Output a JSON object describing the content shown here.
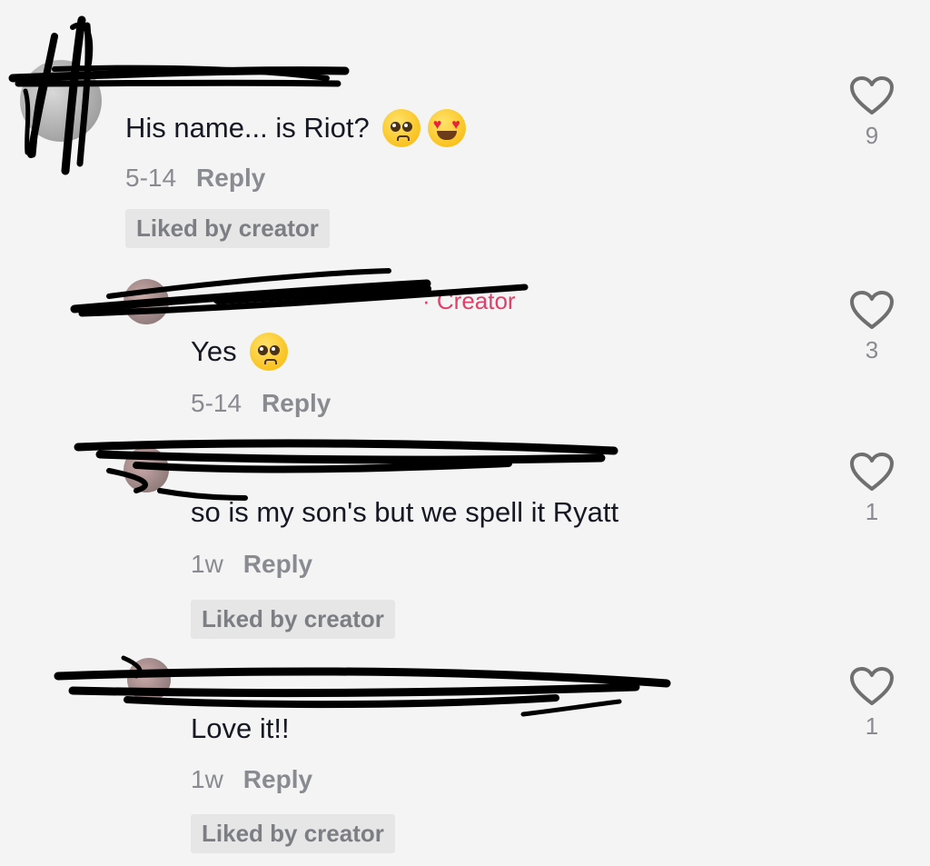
{
  "comments": [
    {
      "text": "His name... is Riot?",
      "emojis": [
        "pleading-face-emoji",
        "heart-eyes-emoji"
      ],
      "date": "5-14",
      "reply_label": "Reply",
      "badge": "Liked by creator",
      "likes": "9"
    },
    {
      "creator_tag": "· Creator",
      "text": "Yes",
      "emojis": [
        "pleading-face-emoji"
      ],
      "date": "5-14",
      "reply_label": "Reply",
      "likes": "3"
    },
    {
      "text": "so is my son's but we spell it Ryatt",
      "date": "1w",
      "reply_label": "Reply",
      "badge": "Liked by creator",
      "likes": "1"
    },
    {
      "text": "Love it!!",
      "date": "1w",
      "reply_label": "Reply",
      "badge": "Liked by creator",
      "likes": "1"
    }
  ],
  "colors": {
    "background": "#f4f4f4",
    "text": "#161823",
    "muted": "#8a8b91",
    "creator_accent": "#e0406a",
    "badge_bg": "#e6e6e6",
    "redaction": "#000000"
  },
  "icons": [
    "heart-outline-icon"
  ]
}
